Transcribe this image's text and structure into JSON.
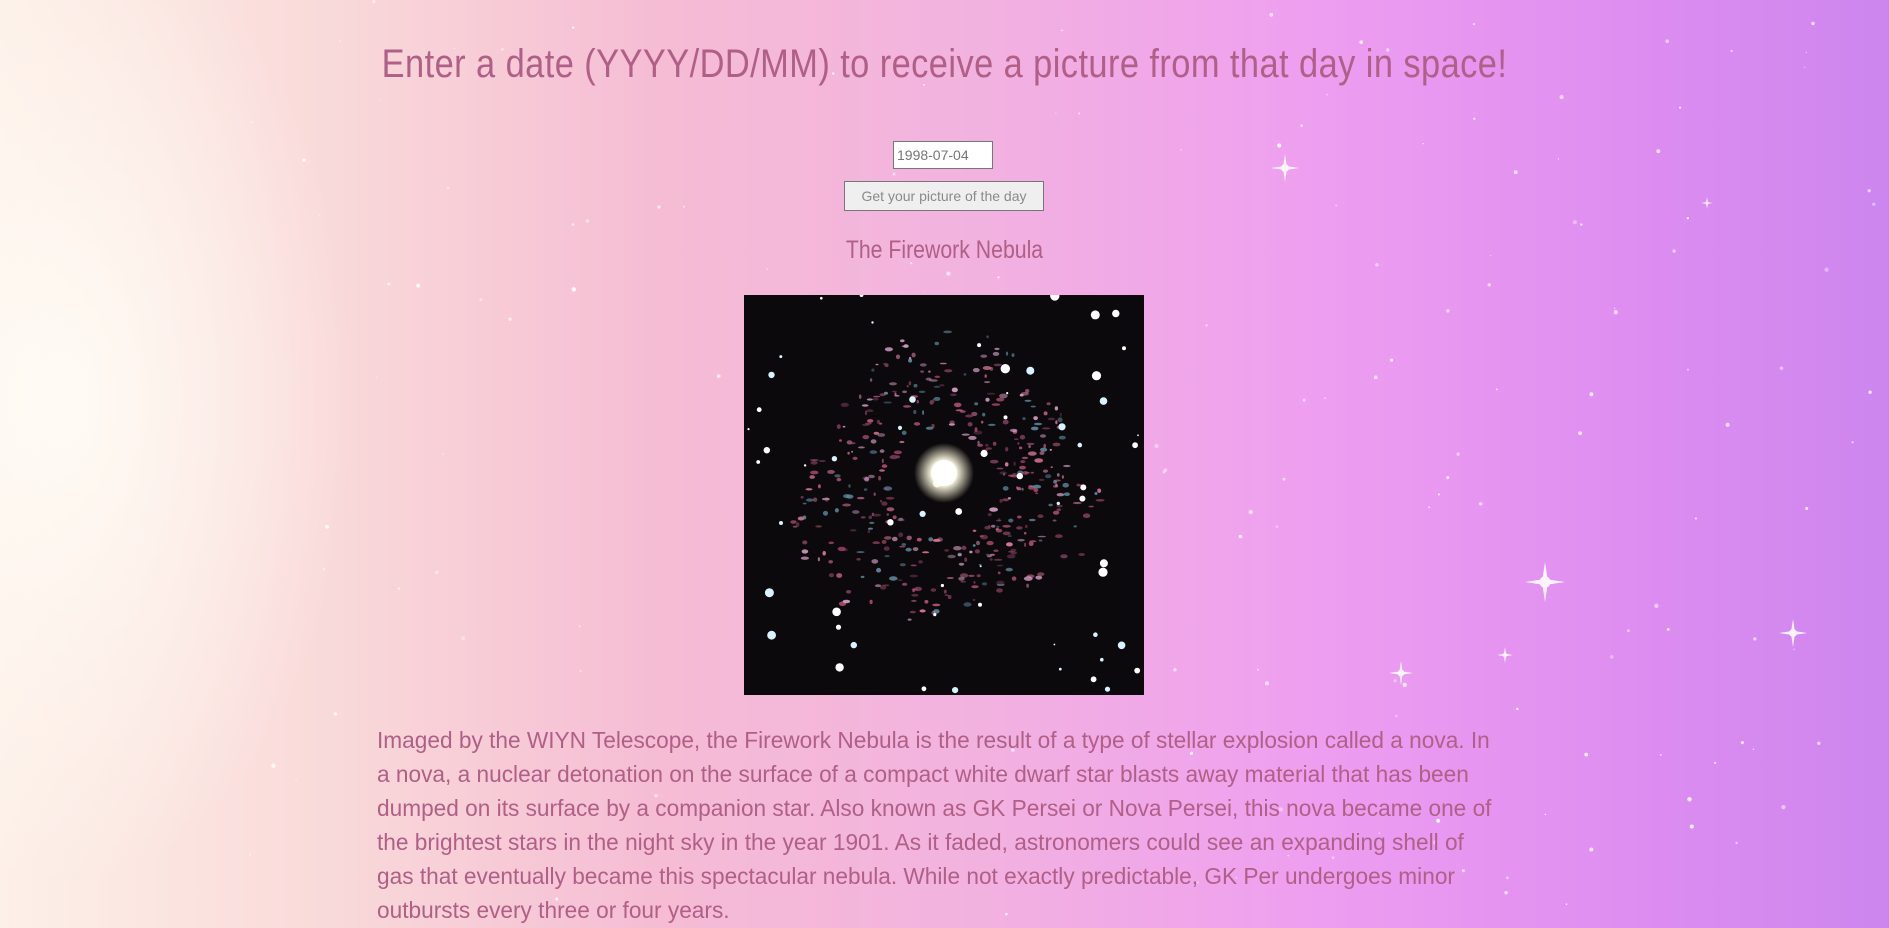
{
  "heading": "Enter a date (YYYY/DD/MM) to receive a picture from that day in space!",
  "form": {
    "date_placeholder": "1998-07-04",
    "date_value": "",
    "submit_label": "Get your picture of the day"
  },
  "apod": {
    "title": "The Firework Nebula",
    "image_alt": "The Firework Nebula",
    "explanation": "Imaged by the WIYN Telescope, the Firework Nebula is the result of a type of stellar explosion called a nova. In a nova, a nuclear detonation on the surface of a compact white dwarf star blasts away material that has been dumped on its surface by a companion star. Also known as GK Persei or Nova Persei, this nova became one of the brightest stars in the night sky in the year 1901. As it faded, astronomers could see an expanding shell of gas that eventually became this spectacular nebula. While not exactly predictable, GK Per undergoes minor outbursts every three or four years."
  },
  "colors": {
    "text": "#b05f86",
    "background_left": "#fdf0e8",
    "background_right": "#cc86ee"
  }
}
